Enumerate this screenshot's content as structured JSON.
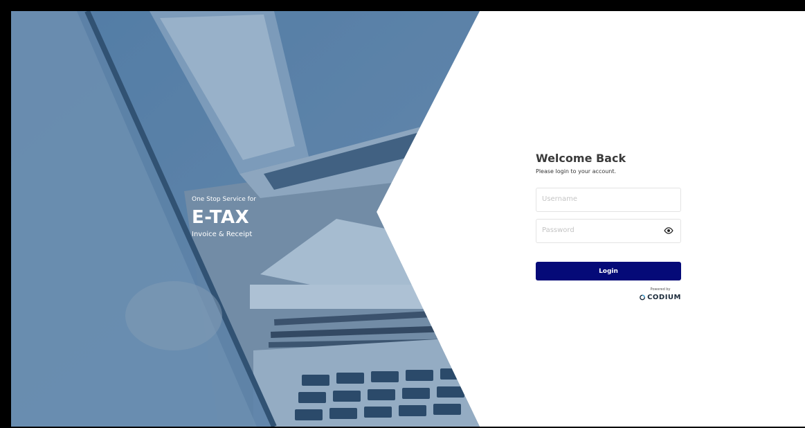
{
  "hero": {
    "tagline_small": "One Stop Service for",
    "tagline_big": "E-TAX",
    "tagline_sub": "Invoice & Receipt",
    "overlay_color": "#3d6b99"
  },
  "login": {
    "title": "Welcome Back",
    "subtitle": "Please login to your account.",
    "username_placeholder": "Username",
    "password_placeholder": "Password",
    "password_toggle_icon": "eye-icon",
    "login_label": "Login",
    "button_color": "#050a78"
  },
  "footer": {
    "powered_by": "Powered by",
    "brand_name": "CODIUM",
    "brand_icon": "codium-logo-icon"
  }
}
